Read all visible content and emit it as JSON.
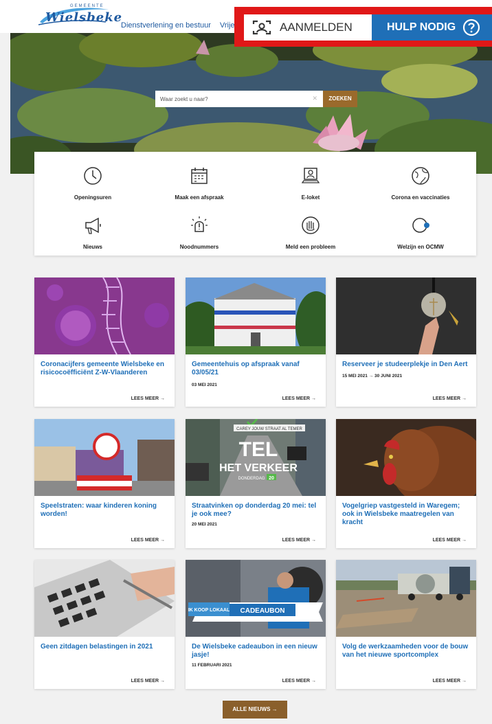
{
  "header": {
    "logo_small": "GEMEENTE",
    "logo_text": "Wielsbeke",
    "nav": [
      "Dienstverlening en bestuur",
      "Vrije"
    ],
    "login_label": "AANMELDEN",
    "help_label": "HULP NODIG"
  },
  "search": {
    "placeholder": "Waar zoekt u naar?",
    "button_label": "ZOEKEN"
  },
  "quick_links": [
    {
      "label": "Openingsuren",
      "icon": "clock-icon"
    },
    {
      "label": "Maak een afspraak",
      "icon": "calendar-icon"
    },
    {
      "label": "E-loket",
      "icon": "computer-user-icon"
    },
    {
      "label": "Corona en vaccinaties",
      "icon": "globe-icon"
    },
    {
      "label": "Nieuws",
      "icon": "megaphone-icon"
    },
    {
      "label": "Noodnummers",
      "icon": "alarm-light-icon"
    },
    {
      "label": "Meld een probleem",
      "icon": "raised-hand-icon"
    },
    {
      "label": "Welzijn en OCMW",
      "icon": "welfare-icon"
    }
  ],
  "news": [
    {
      "title": "Coronacijfers gemeente Wielsbeke en risicocoëfficiënt Z-W-Vlaanderen",
      "date": "",
      "more": "LEES MEER"
    },
    {
      "title": "Gemeentehuis op afspraak vanaf 03/05/21",
      "date": "03 MEI 2021",
      "more": "LEES MEER"
    },
    {
      "title": "Reserveer je studeerplekje in Den Aert",
      "date": "15 MEI 2021 → 30 JUNI 2021",
      "more": "LEES MEER"
    },
    {
      "title": "Speelstraten: waar kinderen koning worden!",
      "date": "",
      "more": "LEES MEER"
    },
    {
      "title": "Straatvinken op donderdag 20 mei: tel je ook mee?",
      "date": "20 MEI 2021",
      "more": "LEES MEER"
    },
    {
      "title": "Vogelgriep vastgesteld in Waregem; ook in Wielsbeke maatregelen van kracht",
      "date": "",
      "more": "LEES MEER"
    },
    {
      "title": "Geen zitdagen belastingen in 2021",
      "date": "",
      "more": "LEES MEER"
    },
    {
      "title": "De Wielsbeke cadeaubon in een nieuw jasje!",
      "date": "11 FEBRUARI 2021",
      "more": "LEES MEER"
    },
    {
      "title": "Volg de werkzaamheden voor de bouw van het nieuwe sportcomplex",
      "date": "",
      "more": "LEES MEER"
    }
  ],
  "image_text": {
    "banner_left": "CAREY JOUW STRAAT AL TEMER",
    "tel": "TEL",
    "verkeer": "HET VERKEER",
    "donderdag": "DONDERDAG",
    "date_num": "20",
    "voucher_top": "IK KOOP LOKAAL",
    "voucher_main": "CADEAUBON"
  },
  "all_news_label": "ALLE NIEUWS",
  "colors": {
    "brand_blue": "#1f6fb7",
    "accent_brown": "#8a5f2b",
    "highlight_red": "#e01818"
  }
}
